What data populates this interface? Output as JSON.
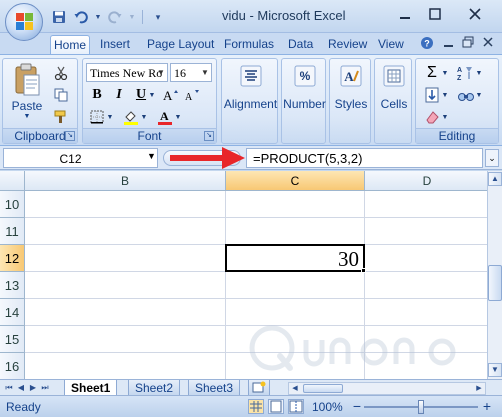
{
  "window": {
    "title": "vidu - Microsoft Excel",
    "controls": [
      "minimize-icon",
      "maximize-icon",
      "close-icon"
    ]
  },
  "quick_access": [
    "save-icon",
    "undo-icon",
    "redo-icon",
    "customize-icon"
  ],
  "ribbon_tabs": [
    "Home",
    "Insert",
    "Page Layout",
    "Formulas",
    "Data",
    "Review",
    "View"
  ],
  "active_tab": "Home",
  "ribbon": {
    "clipboard": {
      "label": "Clipboard",
      "paste_label": "Paste"
    },
    "font": {
      "label": "Font",
      "font_name": "Times New Ro",
      "font_size": "16",
      "bold": "B",
      "italic": "I",
      "underline": "U"
    },
    "alignment": {
      "label": "Alignment"
    },
    "number": {
      "label": "Number"
    },
    "styles": {
      "label": "Styles"
    },
    "cells": {
      "label": "Cells"
    },
    "editing": {
      "label": "Editing"
    }
  },
  "formula_bar": {
    "name_box": "C12",
    "formula": "=PRODUCT(5,3,2)"
  },
  "grid": {
    "columns": [
      "B",
      "C",
      "D"
    ],
    "selected_column": "C",
    "rows": [
      "10",
      "11",
      "12",
      "13",
      "14",
      "15",
      "16"
    ],
    "selected_row": "12",
    "active_cell_value": "30"
  },
  "sheets": [
    "Sheet1",
    "Sheet2",
    "Sheet3"
  ],
  "active_sheet": "Sheet1",
  "status": {
    "text": "Ready",
    "zoom": "100%"
  },
  "colors": {
    "accent_red": "#e8262a",
    "selection_header": "#f8c874"
  }
}
